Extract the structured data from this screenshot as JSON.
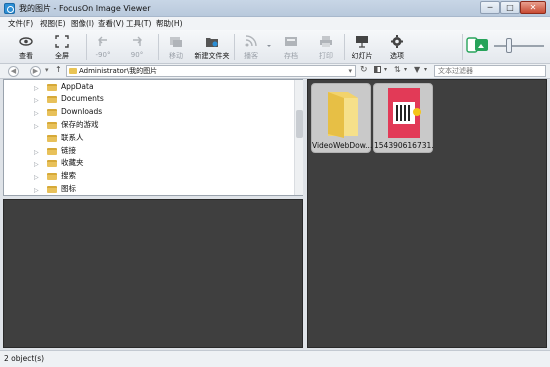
{
  "window": {
    "title": "我的图片 - FocusOn Image Viewer",
    "min": "─",
    "max": "□",
    "close": "✕"
  },
  "menu": [
    "文件(F)",
    "视图(E)",
    "图像(I)",
    "查看(V)",
    "工具(T)",
    "帮助(H)"
  ],
  "toolbar": {
    "view": "查看",
    "fullscreen": "全屏",
    "rotate_left": "-90°",
    "rotate_right": "90°",
    "move": "移动",
    "new_folder": "新建文件夹",
    "broadcast": "播客",
    "save": "存档",
    "print": "打印",
    "slideshow": "幻灯片",
    "options": "选项"
  },
  "addressbar": {
    "path": "Administrator\\我的图片",
    "filter_placeholder": "文本过滤器"
  },
  "tree": [
    "AppData",
    "Documents",
    "Downloads",
    "保存的游戏",
    "联系人",
    "链接",
    "收藏夹",
    "搜索",
    "图标"
  ],
  "thumbnails": [
    {
      "caption": "VideoWebDow..."
    },
    {
      "caption": "154390616731..."
    }
  ],
  "status": "2 object(s)",
  "colors": {
    "panel_bg": "#3f3f3f",
    "accent": "#2b8fd6"
  }
}
